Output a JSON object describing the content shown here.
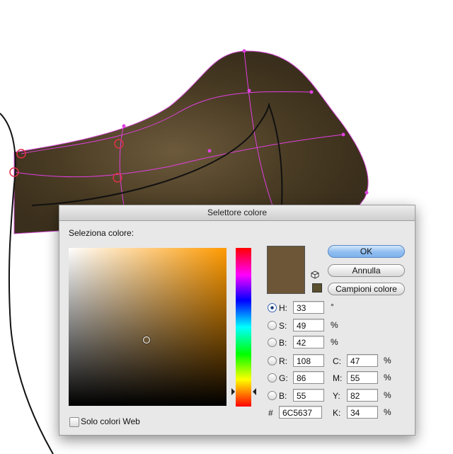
{
  "dialog": {
    "title": "Selettore colore",
    "select_label": "Seleziona colore:",
    "buttons": {
      "ok": "OK",
      "cancel": "Annulla",
      "swatches": "Campioni colore"
    },
    "current_color": "#6C5637",
    "web_only_label": "Solo colori Web",
    "web_only_checked": false,
    "hsb": {
      "h": {
        "label": "H:",
        "value": "33",
        "unit": "°"
      },
      "s": {
        "label": "S:",
        "value": "49",
        "unit": "%"
      },
      "b": {
        "label": "B:",
        "value": "42",
        "unit": "%"
      }
    },
    "rgb": {
      "r": {
        "label": "R:",
        "value": "108"
      },
      "g": {
        "label": "G:",
        "value": "86"
      },
      "b": {
        "label": "B:",
        "value": "55"
      }
    },
    "cmyk": {
      "c": {
        "label": "C:",
        "value": "47",
        "unit": "%"
      },
      "m": {
        "label": "M:",
        "value": "55",
        "unit": "%"
      },
      "y": {
        "label": "Y:",
        "value": "82",
        "unit": "%"
      },
      "k": {
        "label": "K:",
        "value": "34",
        "unit": "%"
      }
    },
    "hex": {
      "label": "#",
      "value": "6C5637"
    },
    "selected_mode": "H"
  },
  "icons": {
    "web_safe_warning": "cube-icon",
    "out_of_gamut": "gamut-swatch-icon"
  }
}
